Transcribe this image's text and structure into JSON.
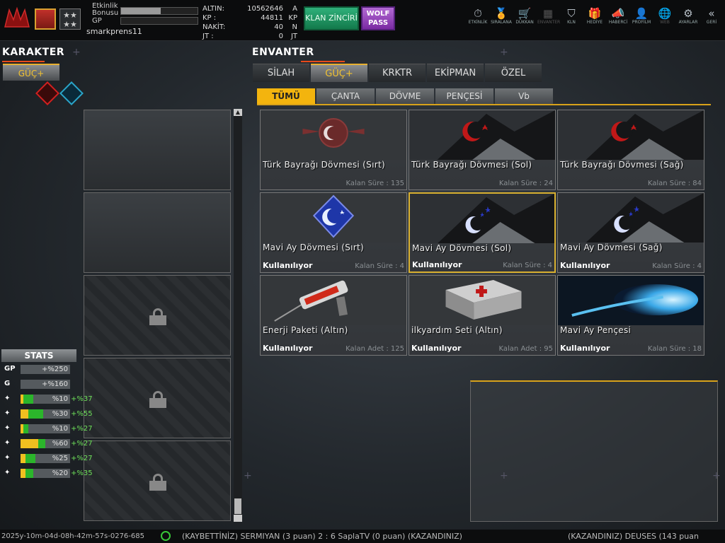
{
  "header": {
    "bonus_label": "Etkinlik\nBonusu",
    "bonus_fill_pct": 52,
    "gp_label": "GP",
    "gp_fill_pct": 0,
    "username": "smarkprens11",
    "currency": [
      {
        "label": "ALTIN:",
        "value": "10562646",
        "unit": "A"
      },
      {
        "label": "KP :",
        "value": "44811",
        "unit": "KP"
      },
      {
        "label": "NAKİT:",
        "value": "40",
        "unit": "N"
      },
      {
        "label": "JT :",
        "value": "0",
        "unit": "JT"
      }
    ],
    "klan_button": "KLAN ZİNCİRİ",
    "wolf_button": "WOLF PASS",
    "nav": [
      {
        "icon": "clock-icon",
        "glyph": "⏱",
        "label": "ETKİNLİK",
        "enabled": true
      },
      {
        "icon": "medal-icon",
        "glyph": "🏅",
        "label": "SIRALANA",
        "enabled": true
      },
      {
        "icon": "cart-icon",
        "glyph": "🛒",
        "label": "DÜKKAN",
        "enabled": true
      },
      {
        "icon": "inventory-icon",
        "glyph": "▦",
        "label": "ENVANTER",
        "enabled": false
      },
      {
        "icon": "shield-icon",
        "glyph": "⛉",
        "label": "KLN",
        "enabled": true
      },
      {
        "icon": "gift-icon",
        "glyph": "🎁",
        "label": "HEDİYE",
        "enabled": true
      },
      {
        "icon": "megaphone-icon",
        "glyph": "📣",
        "label": "HABERCİ",
        "enabled": true
      },
      {
        "icon": "profile-icon",
        "glyph": "👤",
        "label": "PROFİLM",
        "enabled": true
      },
      {
        "icon": "globe-icon",
        "glyph": "🌐",
        "label": "WEB",
        "enabled": false
      },
      {
        "icon": "gear-icon",
        "glyph": "⚙",
        "label": "AYARLAR",
        "enabled": true
      },
      {
        "icon": "back-icon",
        "glyph": "«",
        "label": "GERİ",
        "enabled": true
      }
    ]
  },
  "left": {
    "title": "KARAKTER",
    "tab": "GÜÇ+",
    "stats_title": "STATS",
    "stats": [
      {
        "icon": "GP",
        "yellow": 0,
        "green": 0,
        "value": "+%250",
        "bonus": ""
      },
      {
        "icon": "G",
        "yellow": 0,
        "green": 0,
        "value": "+%160",
        "bonus": ""
      },
      {
        "icon": "run-icon",
        "yellow": 0.06,
        "green": 0.2,
        "value": "%10",
        "bonus": "+%37"
      },
      {
        "icon": "dash-icon",
        "yellow": 0.15,
        "green": 0.3,
        "value": "%30",
        "bonus": "+%55"
      },
      {
        "icon": "reload-icon",
        "yellow": 0.06,
        "green": 0.1,
        "value": "%10",
        "bonus": "+%27"
      },
      {
        "icon": "health-icon",
        "yellow": 0.35,
        "green": 0.15,
        "value": "%60",
        "bonus": "+%27"
      },
      {
        "icon": "recover-icon",
        "yellow": 0.1,
        "green": 0.2,
        "value": "%25",
        "bonus": "+%27"
      },
      {
        "icon": "speed-icon",
        "yellow": 0.1,
        "green": 0.15,
        "value": "%20",
        "bonus": "+%35"
      }
    ]
  },
  "inventory": {
    "title": "ENVANTER",
    "tabs": [
      {
        "label": "SİLAH",
        "active": false
      },
      {
        "label": "GÜÇ+",
        "active": true
      },
      {
        "label": "KRKTR",
        "active": false
      },
      {
        "label": "EKİPMAN",
        "active": false
      },
      {
        "label": "ÖZEL",
        "active": false
      }
    ],
    "subtabs": [
      {
        "label": "TÜMÜ",
        "active": true
      },
      {
        "label": "ÇANTA",
        "active": false
      },
      {
        "label": "DÖVME",
        "active": false
      },
      {
        "label": "PENÇESİ",
        "active": false
      },
      {
        "label": "Vb",
        "active": false
      }
    ],
    "items": [
      {
        "name": "Türk Bayrağı Dövmesi (Sırt)",
        "status": "",
        "meta": "Kalan Süre : 135",
        "art": "emblem-red"
      },
      {
        "name": "Türk Bayrağı Dövmesi (Sol)",
        "status": "",
        "meta": "Kalan Süre : 24",
        "art": "crescent-red"
      },
      {
        "name": "Türk Bayrağı Dövmesi (Sağ)",
        "status": "",
        "meta": "Kalan Süre : 84",
        "art": "crescent-red"
      },
      {
        "name": "Mavi Ay Dövmesi (Sırt)",
        "status": "Kullanılıyor",
        "meta": "Kalan Süre : 4",
        "art": "emblem-blue"
      },
      {
        "name": "Mavi Ay Dövmesi (Sol)",
        "status": "Kullanılıyor",
        "meta": "Kalan Süre : 4",
        "art": "crescent-blue",
        "selected": true
      },
      {
        "name": "Mavi Ay Dövmesi (Sağ)",
        "status": "Kullanılıyor",
        "meta": "Kalan Süre : 4",
        "art": "crescent-blue"
      },
      {
        "name": "Enerji Paketi (Altın)",
        "status": "Kullanılıyor",
        "meta": "Kalan Adet : 125",
        "art": "syringe"
      },
      {
        "name": "ilkyardım Seti (Altın)",
        "status": "Kullanılıyor",
        "meta": "Kalan Adet : 95",
        "art": "medkit"
      },
      {
        "name": "Mavi Ay Pençesi",
        "status": "Kullanılıyor",
        "meta": "Kalan Süre : 18",
        "art": "claw"
      }
    ]
  },
  "ticker": {
    "timestamp": "2025y-10m-04d-08h-42m-57s-0276-685",
    "msg1": "(KAYBETTİNİZ) SERMIYAN (3 puan) 2 : 6 SaplaTV (0 puan) (KAZANDINIZ)",
    "msg2": "(KAZANDINIZ) DEUSES (143 puan"
  },
  "colors": {
    "accent": "#f3b40e",
    "underline": "#e84a1a",
    "klan": "#1f9a66",
    "wolf": "#9a4ac0"
  }
}
